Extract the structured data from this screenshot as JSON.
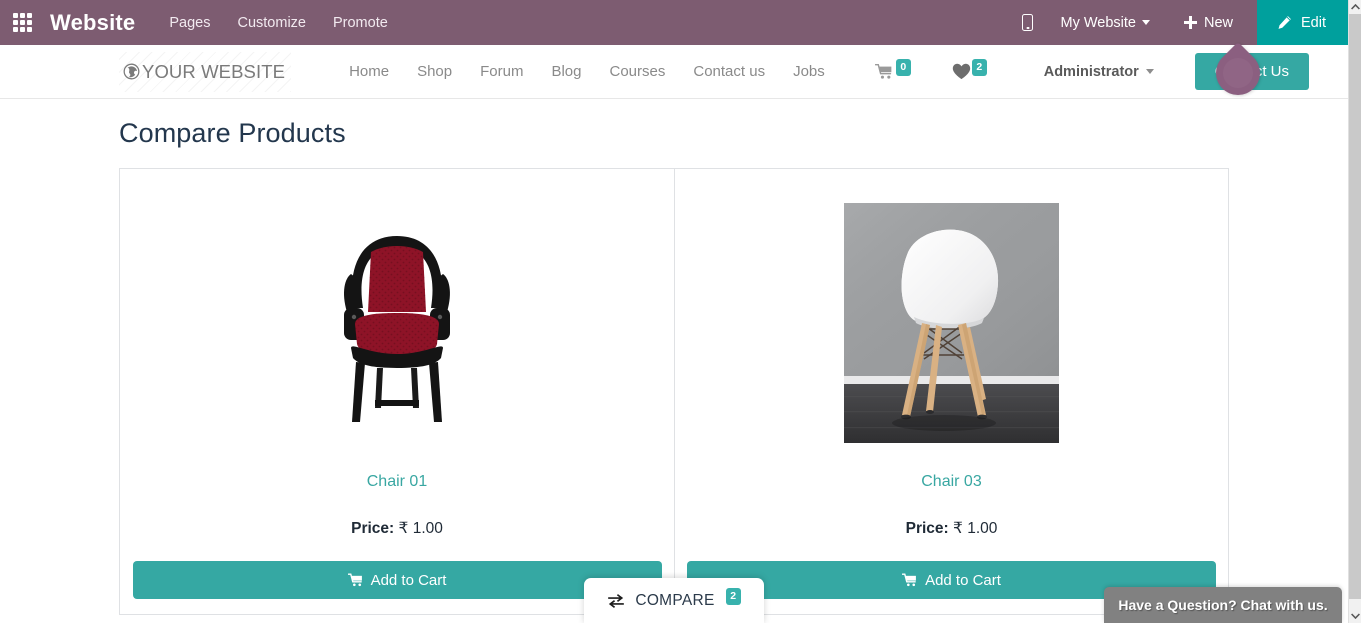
{
  "topbar": {
    "apps_icon": "apps-grid-icon",
    "brand": "Website",
    "menu": [
      {
        "label": "Pages"
      },
      {
        "label": "Customize"
      },
      {
        "label": "Promote"
      }
    ],
    "mobile_icon": "mobile-preview-icon",
    "site_selector": "My Website",
    "new_label": "New",
    "new_icon": "plus-icon",
    "edit_label": "Edit",
    "edit_icon": "pencil-icon",
    "bg_color": "#7d5c71",
    "edit_bg_color": "#00a09d"
  },
  "site_header": {
    "logo_icon": "globe-icon",
    "logo_text": "YOUR WEBSITE",
    "nav": [
      {
        "label": "Home"
      },
      {
        "label": "Shop"
      },
      {
        "label": "Forum"
      },
      {
        "label": "Blog"
      },
      {
        "label": "Courses"
      },
      {
        "label": "Contact us"
      },
      {
        "label": "Jobs"
      }
    ],
    "cart_icon": "shopping-cart-icon",
    "cart_count": "0",
    "wishlist_icon": "heart-icon",
    "wishlist_count": "2",
    "user_menu": "Administrator",
    "cta_label": "Contact Us",
    "cta_color": "#35a8a3",
    "avatar_icon": "user-avatar-drop",
    "avatar_color": "#8b5f80"
  },
  "page": {
    "title": "Compare Products",
    "title_color": "#23374d"
  },
  "products": [
    {
      "name": "Chair 01",
      "image_alt": "black-framed-red-upholstered-armchair",
      "price_label": "Price:",
      "price_value": "₹ 1.00",
      "add_to_cart": "Add to Cart",
      "cart_icon": "shopping-cart-icon"
    },
    {
      "name": "Chair 03",
      "image_alt": "white-eames-style-chair-wooden-legs",
      "price_label": "Price:",
      "price_value": "₹ 1.00",
      "add_to_cart": "Add to Cart",
      "cart_icon": "shopping-cart-icon"
    }
  ],
  "compare_bar": {
    "icon": "exchange-arrows-icon",
    "label": "COMPARE",
    "count": "2",
    "badge_color": "#38b2ad"
  },
  "chat": {
    "label": "Have a Question? Chat with us.",
    "bg_color": "#818181"
  },
  "scrollbar": {
    "up_icon": "chevron-up-icon",
    "down_icon": "chevron-down-icon"
  }
}
